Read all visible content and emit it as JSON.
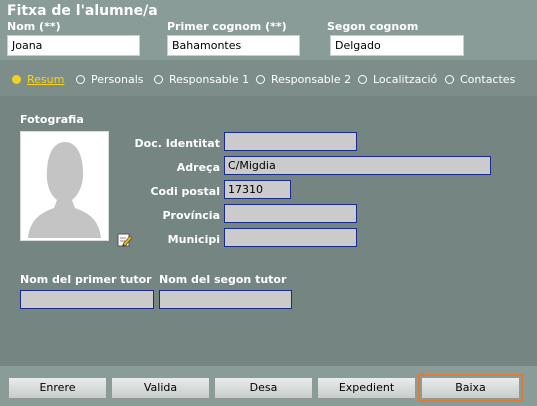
{
  "form_title": "Fitxa de l'alumne/a",
  "header": {
    "nom_label": "Nom (**)",
    "nom_value": "Joana",
    "cognom1_label": "Primer cognom (**)",
    "cognom1_value": "Bahamontes",
    "cognom2_label": "Segon cognom",
    "cognom2_value": "Delgado"
  },
  "tabs": [
    {
      "label": "Resum",
      "active": true
    },
    {
      "label": "Personals",
      "active": false
    },
    {
      "label": "Responsable 1",
      "active": false
    },
    {
      "label": "Responsable 2",
      "active": false
    },
    {
      "label": "Localització",
      "active": false
    },
    {
      "label": "Contactes",
      "active": false
    }
  ],
  "photo_title": "Fotografia",
  "fields": {
    "doc_label": "Doc. Identitat",
    "doc_value": "",
    "adreca_label": "Adreça",
    "adreca_value": "C/Migdia",
    "cp_label": "Codi postal",
    "cp_value": "17310",
    "provincia_label": "Província",
    "provincia_value": "",
    "municipi_label": "Municipi",
    "municipi_value": ""
  },
  "tutors": {
    "tutor1_label": "Nom del primer tutor",
    "tutor1_value": "",
    "tutor2_label": "Nom del segon tutor",
    "tutor2_value": ""
  },
  "buttons": {
    "enrere": "Enrere",
    "valida": "Valida",
    "desa": "Desa",
    "expedient": "Expedient",
    "baixa": "Baixa"
  },
  "colors": {
    "background": "#7d8e8a",
    "active_tab": "#f5d51c",
    "field_border": "#1a2a8c",
    "focus_outline": "#e07a34"
  },
  "icons": [
    "pencil-edit-icon",
    "photo-placeholder-icon"
  ]
}
